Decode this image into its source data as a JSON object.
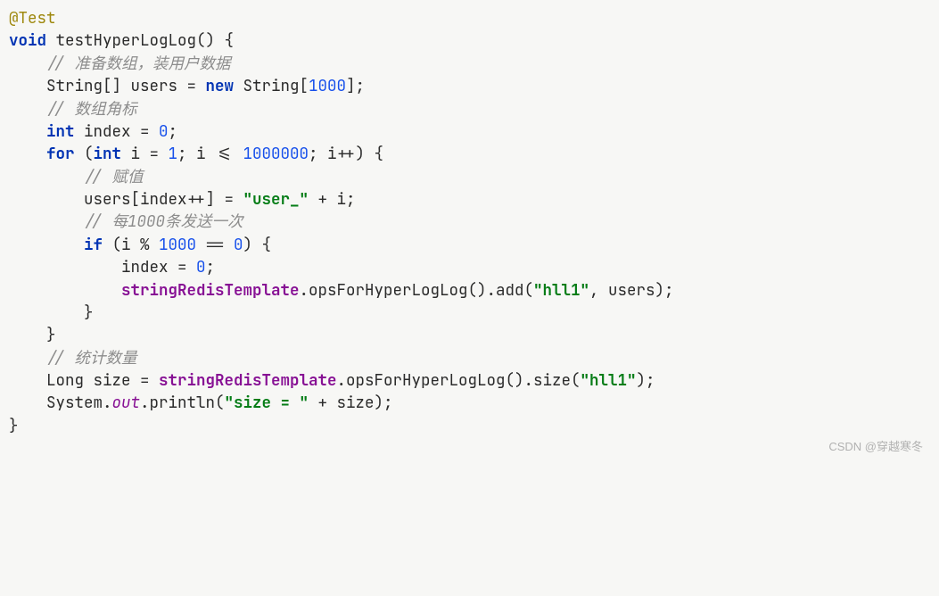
{
  "watermark": "CSDN @穿越寒冬",
  "code": {
    "l1": {
      "annotation": "@Test"
    },
    "l2": {
      "k1": "void",
      "t1": " testHyperLogLog() {"
    },
    "l3": {
      "indent": "    ",
      "comment": "// 准备数组，装用户数据"
    },
    "l4": {
      "indent": "    ",
      "t1": "String",
      "t2": "[] users = ",
      "k1": "new",
      "t3": " String[",
      "n1": "1000",
      "t4": "];"
    },
    "l5": {
      "indent": "    ",
      "comment": "// 数组角标"
    },
    "l6": {
      "indent": "    ",
      "k1": "int",
      "t1": " index = ",
      "n1": "0",
      "t2": ";"
    },
    "l7": {
      "indent": "    ",
      "k1": "for",
      "t1": " (",
      "k2": "int",
      "t2": " i = ",
      "n1": "1",
      "t3": "; i <= ",
      "n2": "1000000",
      "t4": "; i++) {"
    },
    "l8": {
      "indent": "        ",
      "comment": "// 赋值"
    },
    "l9": {
      "indent": "        ",
      "t1": "users[index++] = ",
      "s1": "\"user_\"",
      "t2": " + i;"
    },
    "l10": {
      "indent": "        ",
      "comment": "// 每1000条发送一次"
    },
    "l11": {
      "indent": "        ",
      "k1": "if",
      "t1": " (i % ",
      "n1": "1000",
      "t2": " == ",
      "n2": "0",
      "t3": ") {"
    },
    "l12": {
      "indent": "            ",
      "t1": "index = ",
      "n1": "0",
      "t2": ";"
    },
    "l13": {
      "indent": "            ",
      "f1": "stringRedisTemplate",
      "t1": ".opsForHyperLogLog().add(",
      "s1": "\"hll1\"",
      "t2": ", users);"
    },
    "l14": {
      "indent": "        ",
      "t1": "}"
    },
    "l15": {
      "indent": "    ",
      "t1": "}"
    },
    "l16": {
      "indent": "    ",
      "comment": "// 统计数量"
    },
    "l17": {
      "indent": "    ",
      "t1": "Long size = ",
      "f1": "stringRedisTemplate",
      "t2": ".opsForHyperLogLog().size(",
      "s1": "\"hll1\"",
      "t3": ");"
    },
    "l18": {
      "indent": "    ",
      "t1": "System.",
      "f1": "out",
      "t2": ".println(",
      "s1": "\"size = \"",
      "t3": " + size);"
    },
    "l19": {
      "t1": "}"
    }
  }
}
